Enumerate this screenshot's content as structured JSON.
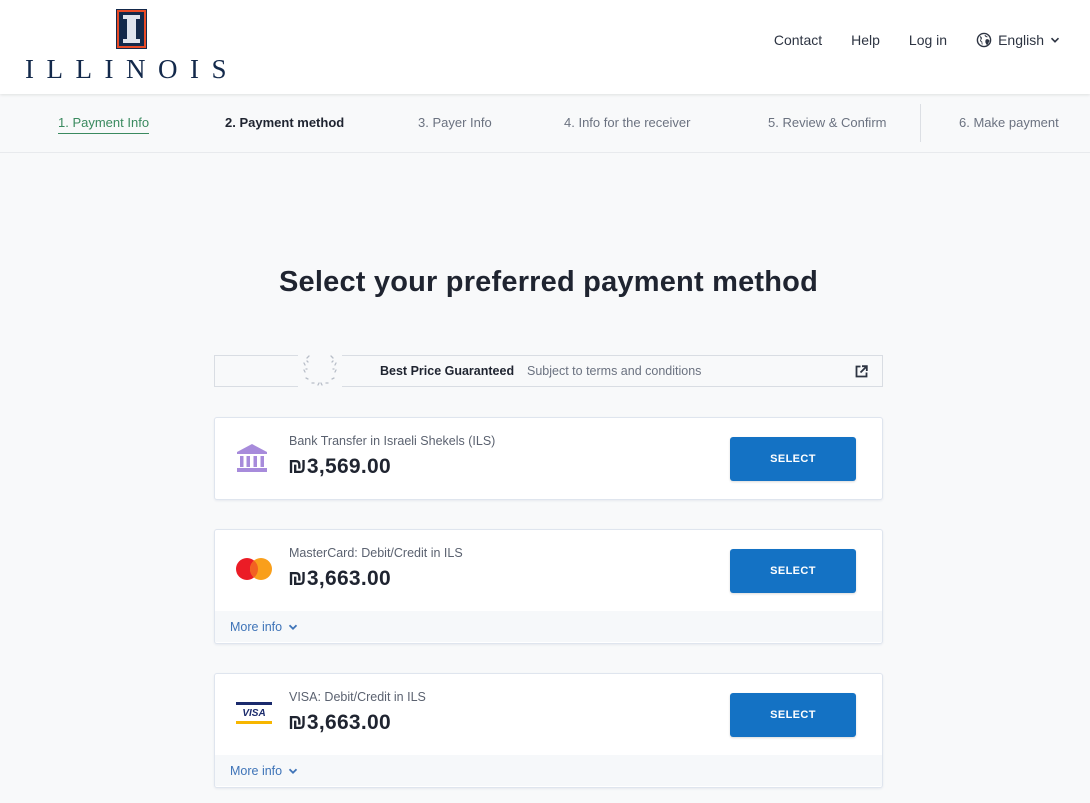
{
  "header": {
    "logo_text": "ILLINOIS",
    "nav": {
      "contact": "Contact",
      "help": "Help",
      "login": "Log in",
      "language": "English"
    },
    "icons": {
      "language": "globe-icon",
      "language_dropdown": "chevron-down-icon"
    }
  },
  "steps": [
    {
      "label": "1. Payment Info",
      "state": "completed"
    },
    {
      "label": "2. Payment method",
      "state": "active"
    },
    {
      "label": "3. Payer Info",
      "state": "pending"
    },
    {
      "label": "4. Info for the receiver",
      "state": "pending"
    },
    {
      "label": "5. Review & Confirm",
      "state": "pending"
    },
    {
      "label": "6. Make payment",
      "state": "pending"
    }
  ],
  "main": {
    "title": "Select your preferred payment method",
    "guarantee": {
      "title": "Best Price Guaranteed",
      "subtitle": "Subject to terms and conditions",
      "icon": "laurel-icon",
      "link_icon": "external-link-icon"
    },
    "methods": [
      {
        "name": "Bank Transfer in Israeli Shekels (ILS)",
        "price": "₪3,569.00",
        "icon": "bank-icon",
        "button": "SELECT",
        "more_info": null
      },
      {
        "name": "MasterCard: Debit/Credit in ILS",
        "price": "₪3,663.00",
        "icon": "mastercard-icon",
        "button": "SELECT",
        "more_info": "More info"
      },
      {
        "name": "VISA: Debit/Credit in ILS",
        "price": "₪3,663.00",
        "icon": "visa-icon",
        "button": "SELECT",
        "more_info": "More info"
      }
    ]
  },
  "colors": {
    "primary_button": "#1472c4",
    "step_completed": "#3a8a5f",
    "bank_icon": "#a78bdb",
    "link": "#3f74b8",
    "brand_navy": "#13294b",
    "brand_orange": "#e84a27"
  }
}
